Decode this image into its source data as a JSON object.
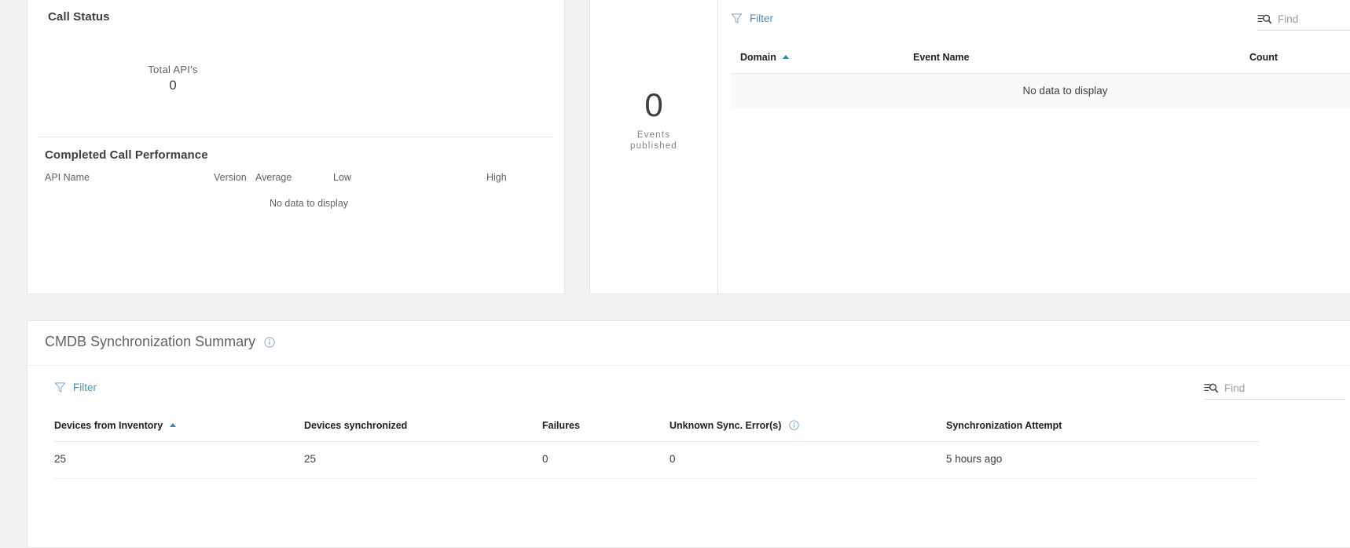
{
  "call_status": {
    "title": "Call Status",
    "total_apis_label": "Total API's",
    "total_apis_value": "0"
  },
  "completed_call_performance": {
    "title": "Completed Call Performance",
    "columns": [
      "API Name",
      "Version",
      "Average",
      "Low",
      "High"
    ],
    "empty_text": "No data to display"
  },
  "events": {
    "count": "0",
    "caption_line1": "Events",
    "caption_line2": "published",
    "filter_label": "Filter",
    "find_placeholder": "Find",
    "find_value": "",
    "columns": [
      "Domain",
      "Event Name",
      "Count"
    ],
    "sorted_column": "Domain",
    "sort_direction": "asc",
    "empty_text": "No data to display"
  },
  "cmdb": {
    "title": "CMDB Synchronization Summary",
    "title_info_icon": "info-icon",
    "filter_label": "Filter",
    "find_placeholder": "Find",
    "find_value": "",
    "columns": [
      "Devices from Inventory",
      "Devices synchronized",
      "Failures",
      "Unknown Sync. Error(s)",
      "Synchronization Attempt"
    ],
    "sorted_column": "Devices from Inventory",
    "sort_direction": "asc",
    "rows": [
      {
        "devices_from_inventory": "25",
        "devices_synchronized": "25",
        "failures": "0",
        "unknown_sync_errors": "0",
        "synchronization_attempt": "5 hours ago"
      }
    ]
  },
  "icons": {
    "filter": "funnel-icon",
    "find": "list-search-icon",
    "sort_asc": "sort-ascending-icon",
    "info": "info-icon"
  },
  "colors": {
    "accent_link": "#4a90b9",
    "sort_arrow": "#2e8ba3",
    "page_background": "#f1f2f3",
    "card_background": "#ffffff",
    "border": "#e4e5e7",
    "text_primary": "#3c4043",
    "text_muted": "#5f6368"
  }
}
